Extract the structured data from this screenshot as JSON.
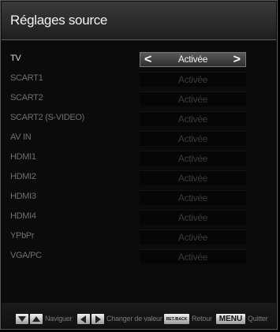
{
  "title": "Réglages source",
  "rows": [
    {
      "label": "TV",
      "value": "Activée",
      "active": true
    },
    {
      "label": "SCART1",
      "value": "Activée",
      "active": false
    },
    {
      "label": "SCART2",
      "value": "Activée",
      "active": false
    },
    {
      "label": "SCART2 (S-VIDEO)",
      "value": "Activée",
      "active": false
    },
    {
      "label": "AV IN",
      "value": "Activée",
      "active": false
    },
    {
      "label": "HDMI1",
      "value": "Activée",
      "active": false
    },
    {
      "label": "HDMI2",
      "value": "Activée",
      "active": false
    },
    {
      "label": "HDMI3",
      "value": "Activée",
      "active": false
    },
    {
      "label": "HDMI4",
      "value": "Activée",
      "active": false
    },
    {
      "label": "YPbPr",
      "value": "Activée",
      "active": false
    },
    {
      "label": "VGA/PC",
      "value": "Activée",
      "active": false
    }
  ],
  "footer": {
    "navigate": "Naviguer",
    "change_value": "Changer de valeur",
    "ret_back_key": "RET./BACK",
    "back": "Retour",
    "menu_key": "MENU",
    "quit": "Quitter"
  },
  "colors": {
    "background": "#0b0b0b",
    "title_bar": "#2a2a2a",
    "active_label": "#d8d8d8",
    "inactive_label": "#6f6f6f"
  }
}
